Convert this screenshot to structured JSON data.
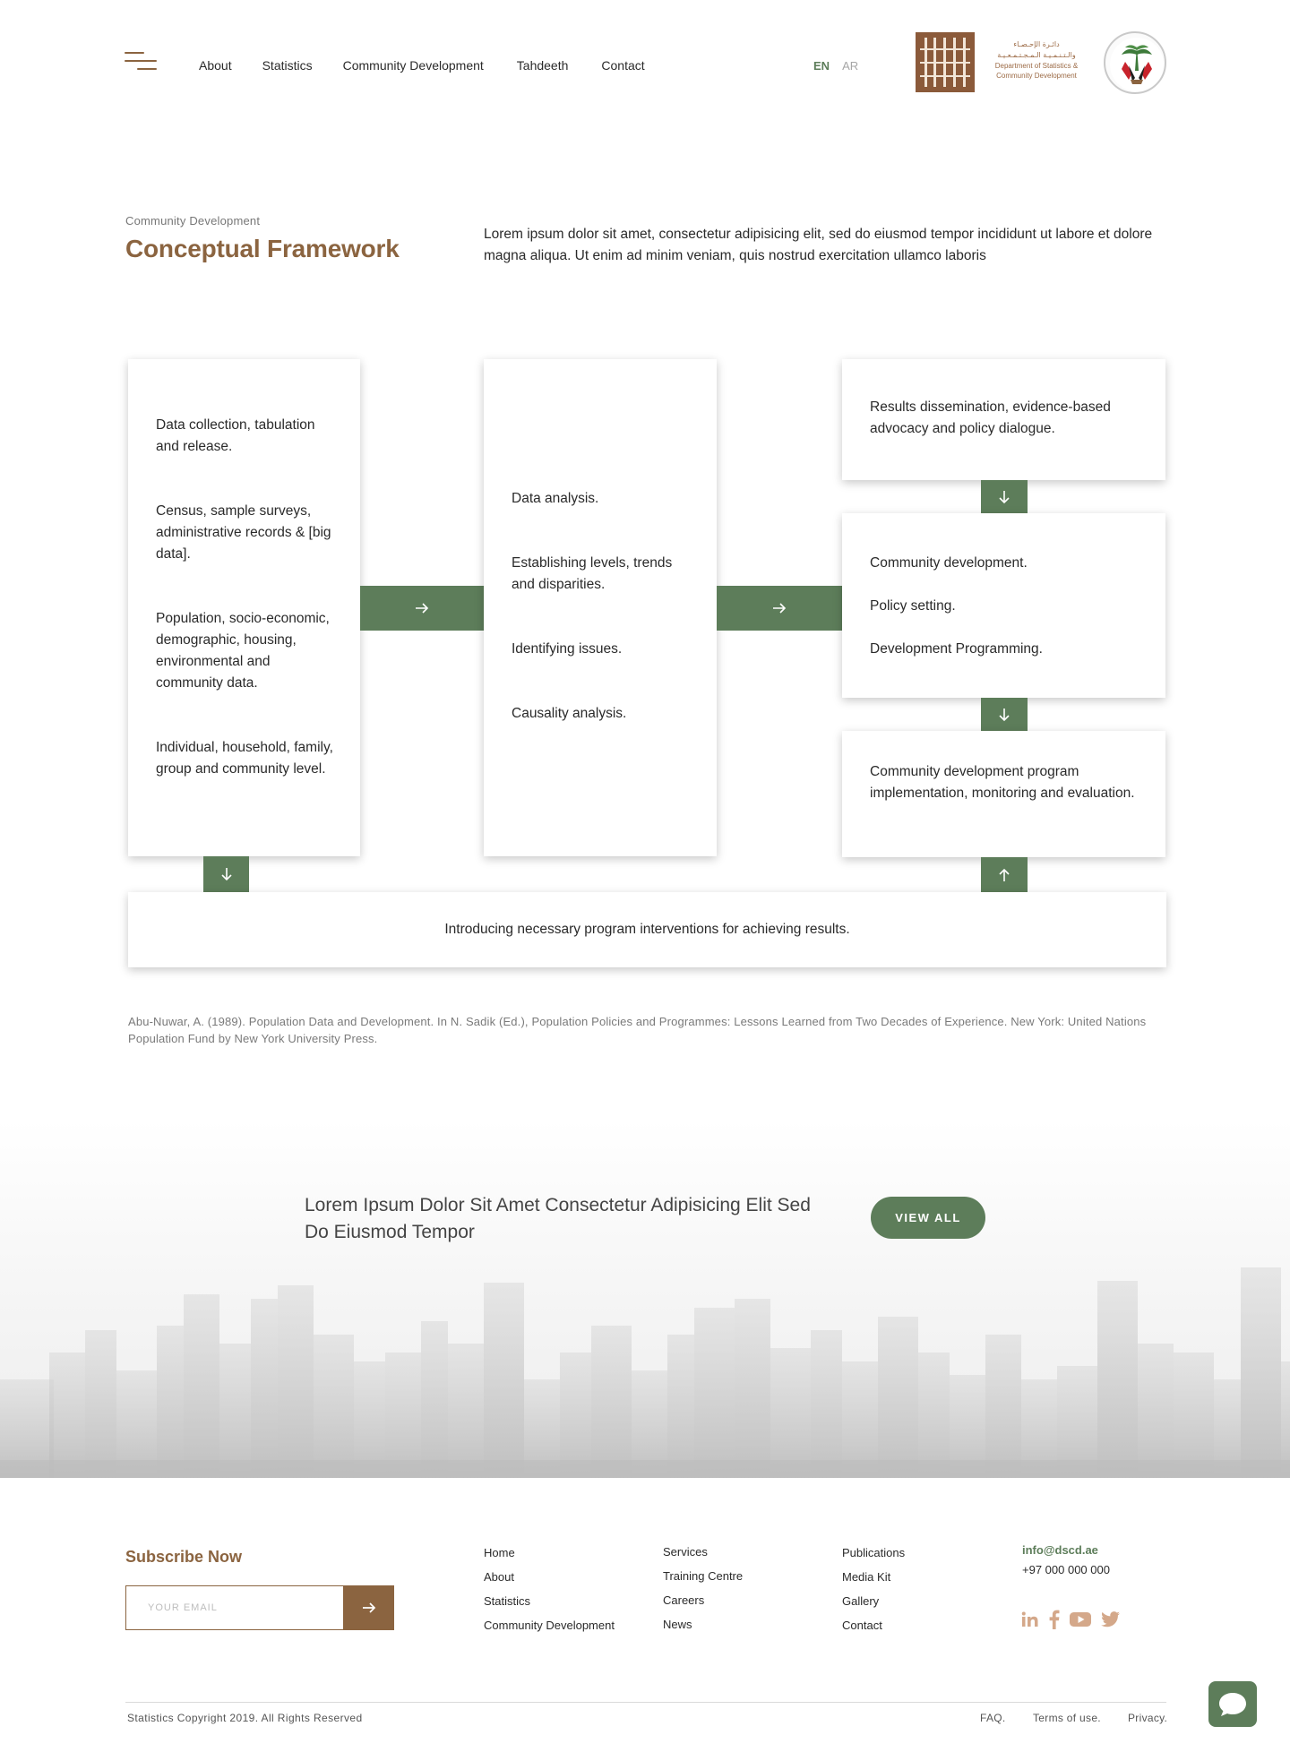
{
  "header": {
    "nav": [
      "About",
      "Statistics",
      "Community Development",
      "Tahdeeth",
      "Contact"
    ],
    "lang_en": "EN",
    "lang_ar": "AR",
    "logo_ar_line1": "دائـرة الإحـصـاء",
    "logo_ar_line2": "والـتـنـمـيـة الـمـجـتـمـعـيـة",
    "logo_en_line1": "Department of Statistics &",
    "logo_en_line2": "Community Development"
  },
  "intro": {
    "kicker": "Community Development",
    "title": "Conceptual Framework",
    "body": "Lorem ipsum dolor sit amet, consectetur adipisicing elit, sed do eiusmod tempor incididunt ut labore et dolore magna aliqua. Ut enim ad minim veniam, quis nostrud exercitation ullamco laboris"
  },
  "framework": {
    "col1": [
      "Data collection, tabulation and release.",
      "Census, sample surveys, administrative records & [big data].",
      "Population, socio-economic, demographic, housing, environmental and community data.",
      "Individual, household, family, group and community level."
    ],
    "col2": [
      "Data analysis.",
      "Establishing levels, trends and disparities.",
      "Identifying issues.",
      "Causality analysis."
    ],
    "col3_top": "Results dissemination, evidence-based advocacy and policy dialogue.",
    "col3_mid": [
      "Community development.",
      "Policy setting.",
      "Development Programming."
    ],
    "col3_bottom": "Community development program implementation, monitoring and evaluation.",
    "banner": "Introducing necessary program interventions for achieving results."
  },
  "citation": "Abu-Nuwar, A. (1989). Population Data and Development. In N. Sadik (Ed.), Population Policies and Programmes: Lessons Learned from Two Decades of Experience. New York: United Nations Population Fund by New York University Press.",
  "cta": {
    "heading": "Lorem Ipsum Dolor Sit Amet Consectetur Adipisicing Elit Sed Do Eiusmod Tempor",
    "button": "VIEW ALL"
  },
  "footer": {
    "subscribe_title": "Subscribe Now",
    "email_placeholder": "YOUR EMAIL",
    "col1": [
      "Home",
      "About",
      "Statistics",
      "Community Development"
    ],
    "col2": [
      "Services",
      "Training Centre",
      "Careers",
      "News"
    ],
    "col3": [
      "Publications",
      "Media Kit",
      "Gallery",
      "Contact"
    ],
    "email": "info@dscd.ae",
    "phone": "+97 000 000 000",
    "social_icons": [
      "linkedin-icon",
      "facebook-icon",
      "youtube-icon",
      "twitter-icon"
    ],
    "copyright": "Statistics Copyright 2019. All Rights Reserved",
    "faq": "FAQ.",
    "terms": "Terms of use.",
    "privacy": "Privacy."
  },
  "colors": {
    "brown": "#8b6440",
    "green": "#5d7d5a",
    "text": "#2a2a2a",
    "muted": "#7a7a7a"
  }
}
